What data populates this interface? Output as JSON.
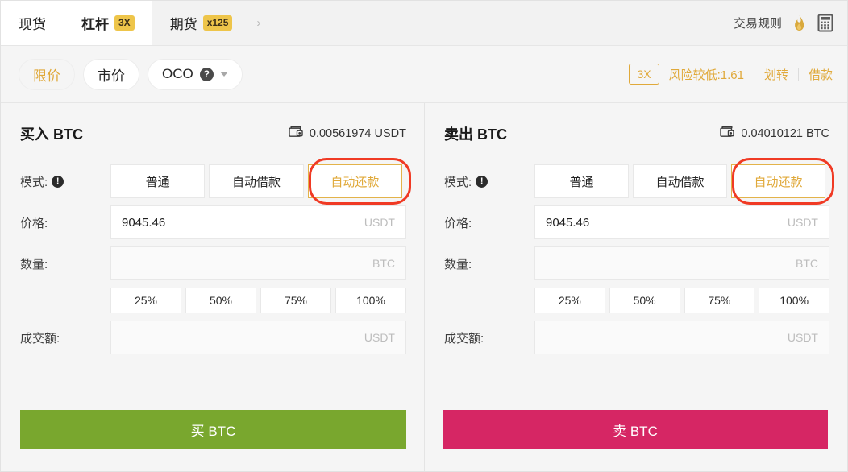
{
  "tabbar": {
    "tabs": [
      {
        "label": "现货",
        "badge": "",
        "active": false
      },
      {
        "label": "杠杆",
        "badge": "3X",
        "active": true
      },
      {
        "label": "期货",
        "badge": "x125",
        "active": false
      }
    ],
    "chevron": "›",
    "rules_label": "交易规则",
    "flame_icon": "flame-icon",
    "calculator_icon": "calculator-icon"
  },
  "typebar": {
    "order_types": [
      {
        "label": "限价",
        "active": true
      },
      {
        "label": "市价",
        "active": false
      },
      {
        "label": "OCO",
        "active": false,
        "help": "?",
        "caret": true
      }
    ],
    "leverage": "3X",
    "risk": "风险较低:1.61",
    "transfer_label": "划转",
    "borrow_label": "借款"
  },
  "buy": {
    "title": "买入 BTC",
    "wallet_icon": "wallet-icon",
    "balance": "0.00561974 USDT",
    "mode_label": "模式:",
    "mode_info": "!",
    "modes": [
      {
        "label": "普通",
        "selected": false
      },
      {
        "label": "自动借款",
        "selected": false
      },
      {
        "label": "自动还款",
        "selected": true
      }
    ],
    "price_label": "价格:",
    "price_value": "9045.46",
    "price_unit": "USDT",
    "amount_label": "数量:",
    "amount_value": "",
    "amount_unit": "BTC",
    "percents": [
      "25%",
      "50%",
      "75%",
      "100%"
    ],
    "total_label": "成交额:",
    "total_value": "",
    "total_unit": "USDT",
    "action_label": "买 BTC",
    "action_color": "#79a72e"
  },
  "sell": {
    "title": "卖出 BTC",
    "wallet_icon": "wallet-icon",
    "balance": "0.04010121 BTC",
    "mode_label": "模式:",
    "mode_info": "!",
    "modes": [
      {
        "label": "普通",
        "selected": false
      },
      {
        "label": "自动借款",
        "selected": false
      },
      {
        "label": "自动还款",
        "selected": true
      }
    ],
    "price_label": "价格:",
    "price_value": "9045.46",
    "price_unit": "USDT",
    "amount_label": "数量:",
    "amount_value": "",
    "amount_unit": "BTC",
    "percents": [
      "25%",
      "50%",
      "75%",
      "100%"
    ],
    "total_label": "成交额:",
    "total_value": "",
    "total_unit": "USDT",
    "action_label": "卖 BTC",
    "action_color": "#d62664"
  },
  "colors": {
    "accent_gold": "#e0a93a",
    "buy_green": "#79a72e",
    "sell_pink": "#d62664",
    "annotation_red": "#f03a24"
  }
}
